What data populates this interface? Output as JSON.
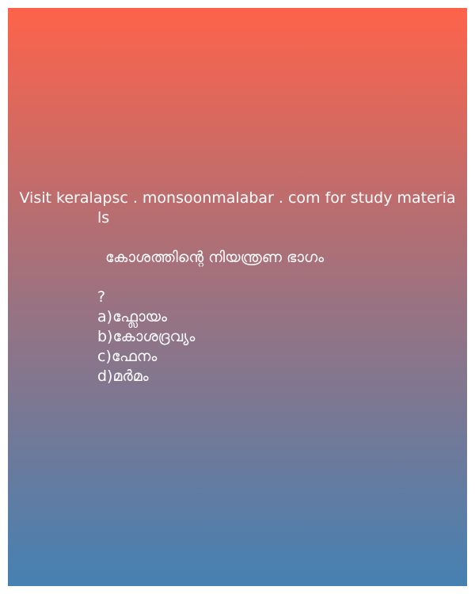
{
  "promo": {
    "line1": "Visit keralapsc . monsoonmalabar . com for study materia",
    "line2": "ls"
  },
  "question": {
    "text": "കോശത്തിന്റെ  നിയന്ത്രണ ഭാഗം",
    "mark": "?"
  },
  "options": [
    {
      "letter": "a)",
      "text": "ഫ്ലോയം"
    },
    {
      "letter": "b)",
      "text": "കോശദ്രവ്യം"
    },
    {
      "letter": "c)",
      "text": "ഫേനം"
    },
    {
      "letter": "d)",
      "text": "മർമം"
    }
  ],
  "colors": {
    "gradient_top": "#fe634a",
    "gradient_mid": "#9c7280",
    "gradient_bottom": "#4581b2",
    "text": "#ffffff"
  }
}
